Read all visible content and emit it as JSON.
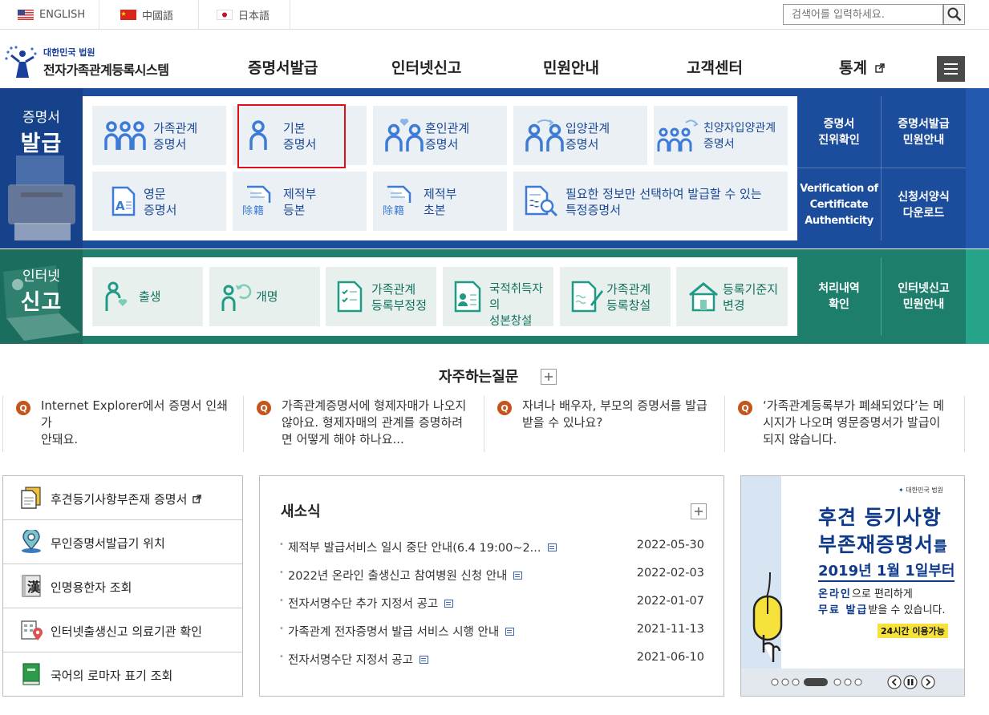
{
  "languages": [
    {
      "label": "ENGLISH",
      "flag": "us-flag-icon"
    },
    {
      "label": "中國語",
      "flag": "china-flag-icon"
    },
    {
      "label": "日本語",
      "flag": "japan-flag-icon"
    }
  ],
  "search": {
    "placeholder": "검색어를 입력하세요."
  },
  "logo": {
    "small": "대한민국 법원",
    "big": "전자가족관계등록시스템"
  },
  "gnb": [
    "증명서발급",
    "인터넷신고",
    "민원안내",
    "고객센터",
    "통계"
  ],
  "certificate": {
    "title_small": "증명서",
    "title_big": "발급",
    "tiles": [
      {
        "label": "가족관계\n증명서",
        "icon": "family-icon"
      },
      {
        "label": "기본\n증명서",
        "icon": "person-icon"
      },
      {
        "label": "혼인관계\n증명서",
        "icon": "couple-heart-icon"
      },
      {
        "label": "입양관계\n증명서",
        "icon": "adoption-icon"
      },
      {
        "label": "친양자입양관계\n증명서",
        "icon": "full-adoption-icon"
      },
      {
        "label": "영문\n증명서",
        "icon": "english-document-icon"
      },
      {
        "label": "제적부\n등본",
        "icon": "removal-register-icon"
      },
      {
        "label": "제적부\n초본",
        "icon": "removal-register-icon"
      },
      {
        "label": "필요한 정보만 선택하여 발급할 수 있는\n특정증명서",
        "icon": "document-search-icon"
      }
    ],
    "side": [
      "증명서\n진위확인",
      "증명서발급\n민원안내",
      "Verification of\nCertificate\nAuthenticity",
      "신청서양식\n다운로드"
    ],
    "tile_stamp": "除籍"
  },
  "report": {
    "title_small": "인터넷",
    "title_big": "신고",
    "tiles": [
      {
        "label": "출생",
        "icon": "birth-icon"
      },
      {
        "label": "개명",
        "icon": "rename-icon"
      },
      {
        "label": "가족관계\n등록부정정",
        "icon": "register-correction-icon"
      },
      {
        "label": "국적취득자의\n성본창설",
        "icon": "naturalization-icon"
      },
      {
        "label": "가족관계\n등록창설",
        "icon": "register-creation-icon"
      },
      {
        "label": "등록기준지\n변경",
        "icon": "house-icon"
      }
    ],
    "side": [
      "처리내역\n확인",
      "인터넷신고\n민원안내"
    ]
  },
  "faq": {
    "title": "자주하는질문",
    "q_mark": "Q",
    "items": [
      "Internet Explorer에서 증명서 인쇄가\n안돼요.",
      "가족관계증명서에 형제자매가 나오지\n않아요. 형제자매의 관계를 증명하려\n면 어떻게 해야 하나요...",
      "자녀나 배우자, 부모의 증명서를 발급\n받을 수 있나요?",
      "‘가족관계등록부가 폐쇄되었다’는 메\n시지가 나오며 영문증명서가 발급이\n되지 않습니다."
    ]
  },
  "quick_links": [
    {
      "label": "후견등기사항부존재 증명서",
      "icon": "document-stack-icon",
      "external": true
    },
    {
      "label": "무인증명서발급기 위치",
      "icon": "location-pin-icon",
      "external": false
    },
    {
      "label": "인명용한자 조회",
      "icon": "hanja-book-icon",
      "hanja": "漢",
      "external": false
    },
    {
      "label": "인터넷출생신고 의료기관 확인",
      "icon": "hospital-location-icon",
      "external": false
    },
    {
      "label": "국어의 로마자 표기 조회",
      "icon": "green-book-icon",
      "external": false
    }
  ],
  "news": {
    "title": "새소식",
    "items": [
      {
        "title": "제적부 발급서비스 일시 중단 안내(6.4 19:00~2...",
        "date": "2022-05-30"
      },
      {
        "title": "2022년 온라인 출생신고 참여병원 신청 안내",
        "date": "2022-02-03"
      },
      {
        "title": "전자서명수단 추가 지정서 공고",
        "date": "2022-01-07"
      },
      {
        "title": "가족관계 전자증명서 발급 서비스 시행 안내",
        "date": "2021-11-13"
      },
      {
        "title": "전자서명수단 지정서 공고",
        "date": "2021-06-10"
      }
    ]
  },
  "banner": {
    "org": "대한민국 법원",
    "line1": "후견 등기사항",
    "line2_main": "부존재증명서",
    "line2_suffix": "를",
    "line3_main": "2019년 1월 1일부터",
    "line4_a": "온라인",
    "line4_b": "으로 편리하게",
    "line5_a": "무료 발급",
    "line5_b": "받을 수 있습니다.",
    "badge": "24시간 이용가능"
  },
  "colors": {
    "blue": "#1c4d9c",
    "green": "#1e7e6c",
    "accent_red": "#e0101a",
    "faq_q": "#c5541c"
  }
}
